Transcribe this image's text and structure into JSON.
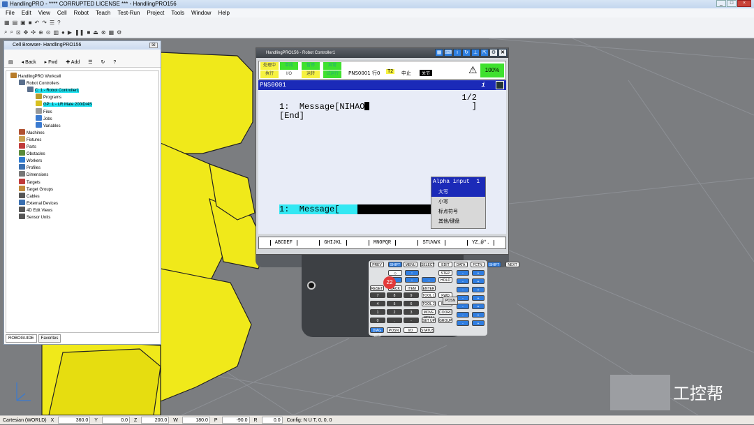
{
  "window": {
    "title": "HandlingPRO - **** CORRUPTED LICENSE *** - HandlingPRO156"
  },
  "menu": [
    "File",
    "Edit",
    "View",
    "Cell",
    "Robot",
    "Teach",
    "Test-Run",
    "Project",
    "Tools",
    "Window",
    "Help"
  ],
  "cell_browser": {
    "title": "Cell Browser- HandlingPRO156",
    "toolbar": {
      "back": "Back",
      "fwd": "Fwd",
      "add": "Add"
    },
    "tree": [
      {
        "label": "HandlingPRO Workcell",
        "icon": "workcell-icon",
        "indent": 0,
        "color": "#b87c2a"
      },
      {
        "label": "Robot Controllers",
        "icon": "controller-icon",
        "indent": 1,
        "color": "#5a6f8c"
      },
      {
        "label": "C: 1 - Robot Controller1",
        "icon": "controller-icon",
        "indent": 2,
        "color": "#5a6f8c",
        "highlight": true
      },
      {
        "label": "Programs",
        "icon": "programs-icon",
        "indent": 3,
        "color": "#b89a2a"
      },
      {
        "label": "GP: 1 - LR Mate 200iD/4S",
        "icon": "robot-icon",
        "indent": 3,
        "color": "#d8c020",
        "highlight": true
      },
      {
        "label": "Files",
        "icon": "files-icon",
        "indent": 3,
        "color": "#999"
      },
      {
        "label": "Jobs",
        "icon": "jobs-icon",
        "indent": 3,
        "color": "#3a7ad0"
      },
      {
        "label": "Variables",
        "icon": "variables-icon",
        "indent": 3,
        "color": "#3a7ad0"
      },
      {
        "label": "Machines",
        "icon": "machines-icon",
        "indent": 1,
        "color": "#b05030"
      },
      {
        "label": "Fixtures",
        "icon": "fixtures-icon",
        "indent": 1,
        "color": "#c9a050"
      },
      {
        "label": "Parts",
        "icon": "parts-icon",
        "indent": 1,
        "color": "#c03a3a"
      },
      {
        "label": "Obstacles",
        "icon": "obstacles-icon",
        "indent": 1,
        "color": "#5a8a3a"
      },
      {
        "label": "Workers",
        "icon": "workers-icon",
        "indent": 1,
        "color": "#2e7ad0"
      },
      {
        "label": "Profiles",
        "icon": "profiles-icon",
        "indent": 1,
        "color": "#3a6fb0"
      },
      {
        "label": "Dimensions",
        "icon": "dimensions-icon",
        "indent": 1,
        "color": "#777"
      },
      {
        "label": "Targets",
        "icon": "targets-icon",
        "indent": 1,
        "color": "#c03a3a"
      },
      {
        "label": "Target Groups",
        "icon": "target-groups-icon",
        "indent": 1,
        "color": "#c08a3a"
      },
      {
        "label": "Cables",
        "icon": "cables-icon",
        "indent": 1,
        "color": "#555"
      },
      {
        "label": "External Devices",
        "icon": "external-devices-icon",
        "indent": 1,
        "color": "#3a6fb0"
      },
      {
        "label": "4D Edit Views",
        "icon": "views-icon",
        "indent": 1,
        "color": "#555"
      },
      {
        "label": "Sensor Units",
        "icon": "sensor-icon",
        "indent": 1,
        "color": "#555"
      }
    ],
    "tabs": [
      "ROBOGUIDE",
      "Favorites"
    ]
  },
  "teach_pendant": {
    "title": "HandlingPRO156 - Robot Controller1",
    "status_cells": [
      "处理中",
      "单段",
      "暂停",
      "异常",
      "执行",
      "I/O",
      "运转",
      "试运行"
    ],
    "status_line": "PNS0001 行0",
    "mode": "T2",
    "state": "中止",
    "joint": "关节",
    "override": "100%",
    "program": "PNS0001",
    "page": "1/2",
    "line1_num": "1:",
    "line1_text": "Message[NIHAO",
    "end_text": "[End]",
    "bracket": "]",
    "input_line": "1:  Message[",
    "alpha_popup": {
      "title": "Alpha input  1",
      "items": [
        "大写",
        "小写",
        "标点符号",
        "其他/键盘"
      ],
      "selected": 0
    },
    "fkeys": [
      "ABCDEF",
      "GHIJKL",
      "MNOPQR",
      "STUVWX",
      "YZ_@*."
    ]
  },
  "pendant_keys": {
    "row1": [
      "PREV",
      "SHIFT",
      "MENU",
      "SELECT",
      "EDIT",
      "DATA",
      "FCTN",
      "SHIFT",
      "NEXT"
    ],
    "misc": [
      "RESET",
      "BACK SPACE",
      "ITEM",
      "ENTER",
      "STEP",
      "HOLD",
      "FWD",
      "BWD",
      "COORD",
      "GROUP",
      "TOOL 1",
      "TOOL 2",
      "MOVE MENU",
      "SET UP",
      "DIAG HELP",
      "POSN",
      "I/O",
      "STATUS",
      "POSN"
    ],
    "digits": [
      "7",
      "8",
      "9",
      "4",
      "5",
      "6",
      "1",
      "2",
      "3",
      "0",
      ".",
      "-",
      ","
    ]
  },
  "badge": "22",
  "statusbar": {
    "coord": "Cartesian (WORLD)",
    "x_label": "X",
    "x": "360.0",
    "y_label": "Y",
    "y": "0.0",
    "z_label": "Z",
    "z": "200.0",
    "w_label": "W",
    "w": "180.0",
    "p_label": "P",
    "p": "-90.0",
    "r_label": "R",
    "r": "0.0",
    "config": "Config: N U T, 0, 0, 0"
  },
  "watermark": "工控帮",
  "colors": {
    "robot": "#f0e91a",
    "background": "#7b7d80",
    "pendant_blue": "#1b2ab8",
    "highlight": "#1ee1f0"
  }
}
